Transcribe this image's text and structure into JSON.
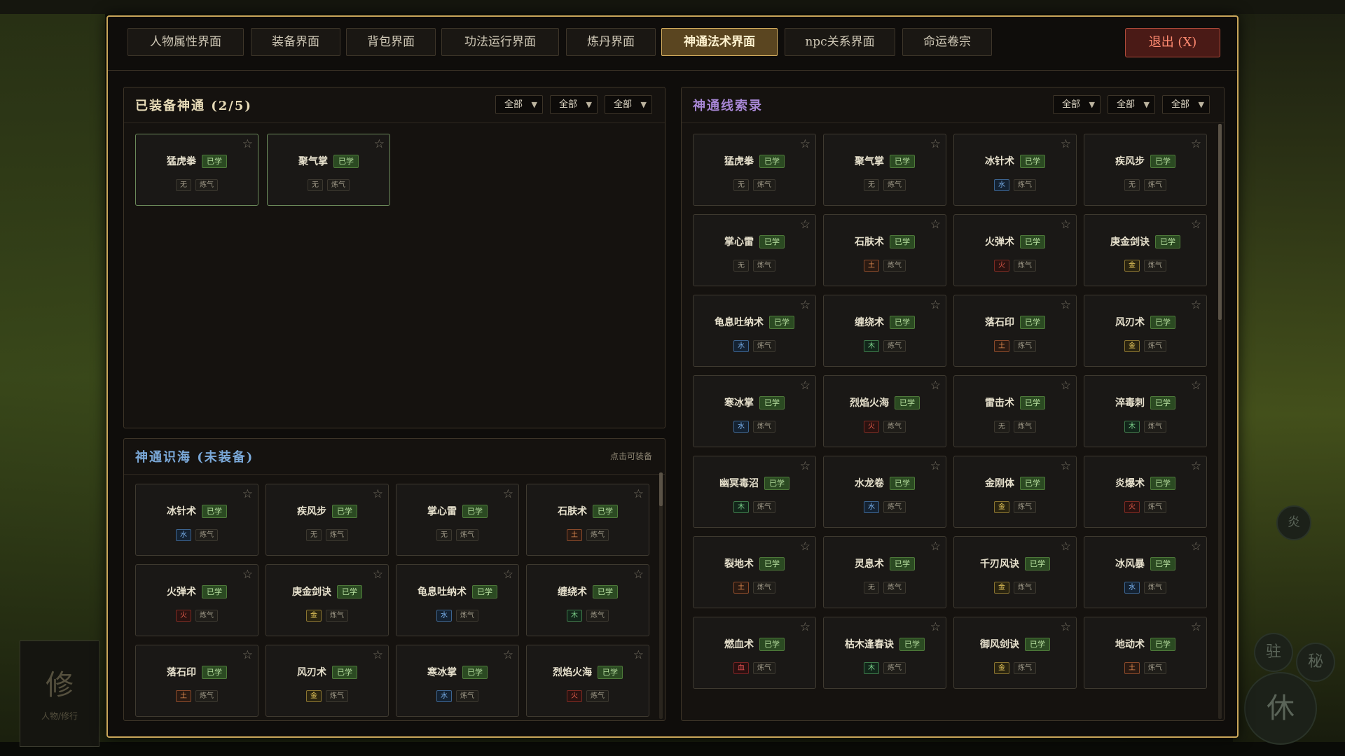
{
  "tabs": [
    {
      "label": "人物属性界面"
    },
    {
      "label": "装备界面"
    },
    {
      "label": "背包界面"
    },
    {
      "label": "功法运行界面"
    },
    {
      "label": "炼丹界面"
    },
    {
      "label": "神通法术界面",
      "active": true
    },
    {
      "label": "npc关系界面"
    },
    {
      "label": "命运卷宗"
    }
  ],
  "exit_label": "退出 (X)",
  "filters": [
    "全部",
    "全部",
    "全部"
  ],
  "equipped": {
    "title": "已装备神通 (2/5)",
    "cards": [
      {
        "name": "猛虎拳",
        "status": "已学",
        "element": "无",
        "realm": "炼气"
      },
      {
        "name": "聚气掌",
        "status": "已学",
        "element": "无",
        "realm": "炼气"
      }
    ]
  },
  "sea": {
    "title": "神通识海 (未装备)",
    "hint": "点击可装备",
    "cards": [
      {
        "name": "冰针术",
        "status": "已学",
        "element": "水",
        "realm": "炼气"
      },
      {
        "name": "疾风步",
        "status": "已学",
        "element": "无",
        "realm": "炼气"
      },
      {
        "name": "掌心雷",
        "status": "已学",
        "element": "无",
        "realm": "炼气"
      },
      {
        "name": "石肤术",
        "status": "已学",
        "element": "土",
        "realm": "炼气"
      },
      {
        "name": "火弹术",
        "status": "已学",
        "element": "火",
        "realm": "炼气"
      },
      {
        "name": "庚金剑诀",
        "status": "已学",
        "element": "金",
        "realm": "炼气"
      },
      {
        "name": "龟息吐纳术",
        "status": "已学",
        "element": "水",
        "realm": "炼气"
      },
      {
        "name": "缠绕术",
        "status": "已学",
        "element": "木",
        "realm": "炼气"
      },
      {
        "name": "落石印",
        "status": "已学",
        "element": "土",
        "realm": "炼气"
      },
      {
        "name": "风刃术",
        "status": "已学",
        "element": "金",
        "realm": "炼气"
      },
      {
        "name": "寒冰掌",
        "status": "已学",
        "element": "水",
        "realm": "炼气"
      },
      {
        "name": "烈焰火海",
        "status": "已学",
        "element": "火",
        "realm": "炼气"
      }
    ]
  },
  "catalog": {
    "title": "神通线索录",
    "cards": [
      {
        "name": "猛虎拳",
        "status": "已学",
        "element": "无",
        "realm": "炼气"
      },
      {
        "name": "聚气掌",
        "status": "已学",
        "element": "无",
        "realm": "炼气"
      },
      {
        "name": "冰针术",
        "status": "已学",
        "element": "水",
        "realm": "炼气"
      },
      {
        "name": "疾风步",
        "status": "已学",
        "element": "无",
        "realm": "炼气"
      },
      {
        "name": "掌心雷",
        "status": "已学",
        "element": "无",
        "realm": "炼气"
      },
      {
        "name": "石肤术",
        "status": "已学",
        "element": "土",
        "realm": "炼气"
      },
      {
        "name": "火弹术",
        "status": "已学",
        "element": "火",
        "realm": "炼气"
      },
      {
        "name": "庚金剑诀",
        "status": "已学",
        "element": "金",
        "realm": "炼气"
      },
      {
        "name": "龟息吐纳术",
        "status": "已学",
        "element": "水",
        "realm": "炼气"
      },
      {
        "name": "缠绕术",
        "status": "已学",
        "element": "木",
        "realm": "炼气"
      },
      {
        "name": "落石印",
        "status": "已学",
        "element": "土",
        "realm": "炼气"
      },
      {
        "name": "风刃术",
        "status": "已学",
        "element": "金",
        "realm": "炼气"
      },
      {
        "name": "寒冰掌",
        "status": "已学",
        "element": "水",
        "realm": "炼气"
      },
      {
        "name": "烈焰火海",
        "status": "已学",
        "element": "火",
        "realm": "炼气"
      },
      {
        "name": "雷击术",
        "status": "已学",
        "element": "无",
        "realm": "炼气"
      },
      {
        "name": "淬毒刺",
        "status": "已学",
        "element": "木",
        "realm": "炼气"
      },
      {
        "name": "幽冥毒沼",
        "status": "已学",
        "element": "木",
        "realm": "炼气"
      },
      {
        "name": "水龙卷",
        "status": "已学",
        "element": "水",
        "realm": "炼气"
      },
      {
        "name": "金刚体",
        "status": "已学",
        "element": "金",
        "realm": "炼气"
      },
      {
        "name": "炎爆术",
        "status": "已学",
        "element": "火",
        "realm": "炼气"
      },
      {
        "name": "裂地术",
        "status": "已学",
        "element": "土",
        "realm": "炼气"
      },
      {
        "name": "灵息术",
        "status": "已学",
        "element": "无",
        "realm": "炼气"
      },
      {
        "name": "千刃风诀",
        "status": "已学",
        "element": "金",
        "realm": "炼气"
      },
      {
        "name": "冰风暴",
        "status": "已学",
        "element": "水",
        "realm": "炼气"
      },
      {
        "name": "燃血术",
        "status": "已学",
        "element": "血",
        "realm": "炼气"
      },
      {
        "name": "枯木逢春诀",
        "status": "已学",
        "element": "木",
        "realm": "炼气"
      },
      {
        "name": "御风剑诀",
        "status": "已学",
        "element": "金",
        "realm": "炼气"
      },
      {
        "name": "地动术",
        "status": "已学",
        "element": "土",
        "realm": "炼气"
      }
    ]
  },
  "background": {
    "left_card_big": "修",
    "left_card_small": "人物/修行",
    "round_buttons": [
      "驻",
      "秘",
      "休",
      "炎"
    ]
  }
}
